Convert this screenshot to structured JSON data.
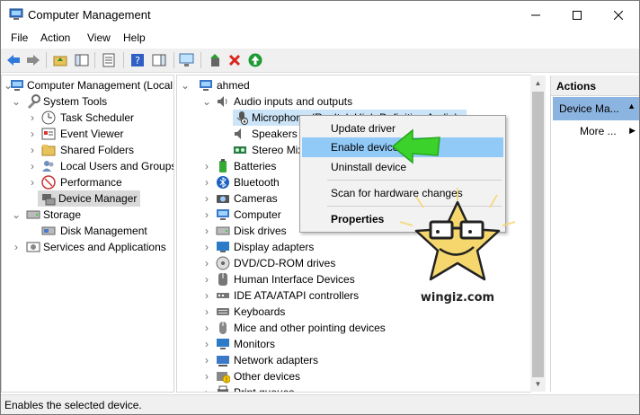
{
  "window": {
    "title": "Computer Management"
  },
  "menu": [
    "File",
    "Action",
    "View",
    "Help"
  ],
  "left_tree": [
    {
      "label": "Computer Management (Local",
      "depth": 0,
      "expanded": true
    },
    {
      "label": "System Tools",
      "depth": 1,
      "expanded": true
    },
    {
      "label": "Task Scheduler",
      "depth": 2,
      "expandable": true
    },
    {
      "label": "Event Viewer",
      "depth": 2,
      "expandable": true
    },
    {
      "label": "Shared Folders",
      "depth": 2,
      "expandable": true
    },
    {
      "label": "Local Users and Groups",
      "depth": 2,
      "expandable": true
    },
    {
      "label": "Performance",
      "depth": 2,
      "expandable": true
    },
    {
      "label": "Device Manager",
      "depth": 2,
      "selected": true
    },
    {
      "label": "Storage",
      "depth": 1,
      "expanded": true
    },
    {
      "label": "Disk Management",
      "depth": 2
    },
    {
      "label": "Services and Applications",
      "depth": 1,
      "expandable": true
    }
  ],
  "device_tree": {
    "root": "ahmed",
    "audio": {
      "label": "Audio inputs and outputs",
      "children": [
        "Microphone (Realtek High Definition Audio)",
        "Speakers (",
        "Stereo Mix"
      ]
    },
    "categories": [
      "Batteries",
      "Bluetooth",
      "Cameras",
      "Computer",
      "Disk drives",
      "Display adapters",
      "DVD/CD-ROM drives",
      "Human Interface Devices",
      "IDE ATA/ATAPI controllers",
      "Keyboards",
      "Mice and other pointing devices",
      "Monitors",
      "Network adapters",
      "Other devices",
      "Print queues"
    ]
  },
  "context_menu": {
    "items": [
      {
        "label": "Update driver"
      },
      {
        "label": "Enable device",
        "highlighted": true
      },
      {
        "label": "Uninstall device"
      },
      {
        "label": "Scan for hardware changes"
      },
      {
        "label": "Properties",
        "bold": true
      }
    ]
  },
  "actions": {
    "header": "Actions",
    "section": "Device Ma...",
    "more": "More ..."
  },
  "statusbar": {
    "text": "Enables the selected device."
  },
  "watermark": {
    "text": "wingiz.com"
  },
  "colors": {
    "selection": "#91c9f7",
    "actions_section": "#8cb4e0",
    "arrow": "#3cd22c",
    "star": "#f5d76e"
  }
}
